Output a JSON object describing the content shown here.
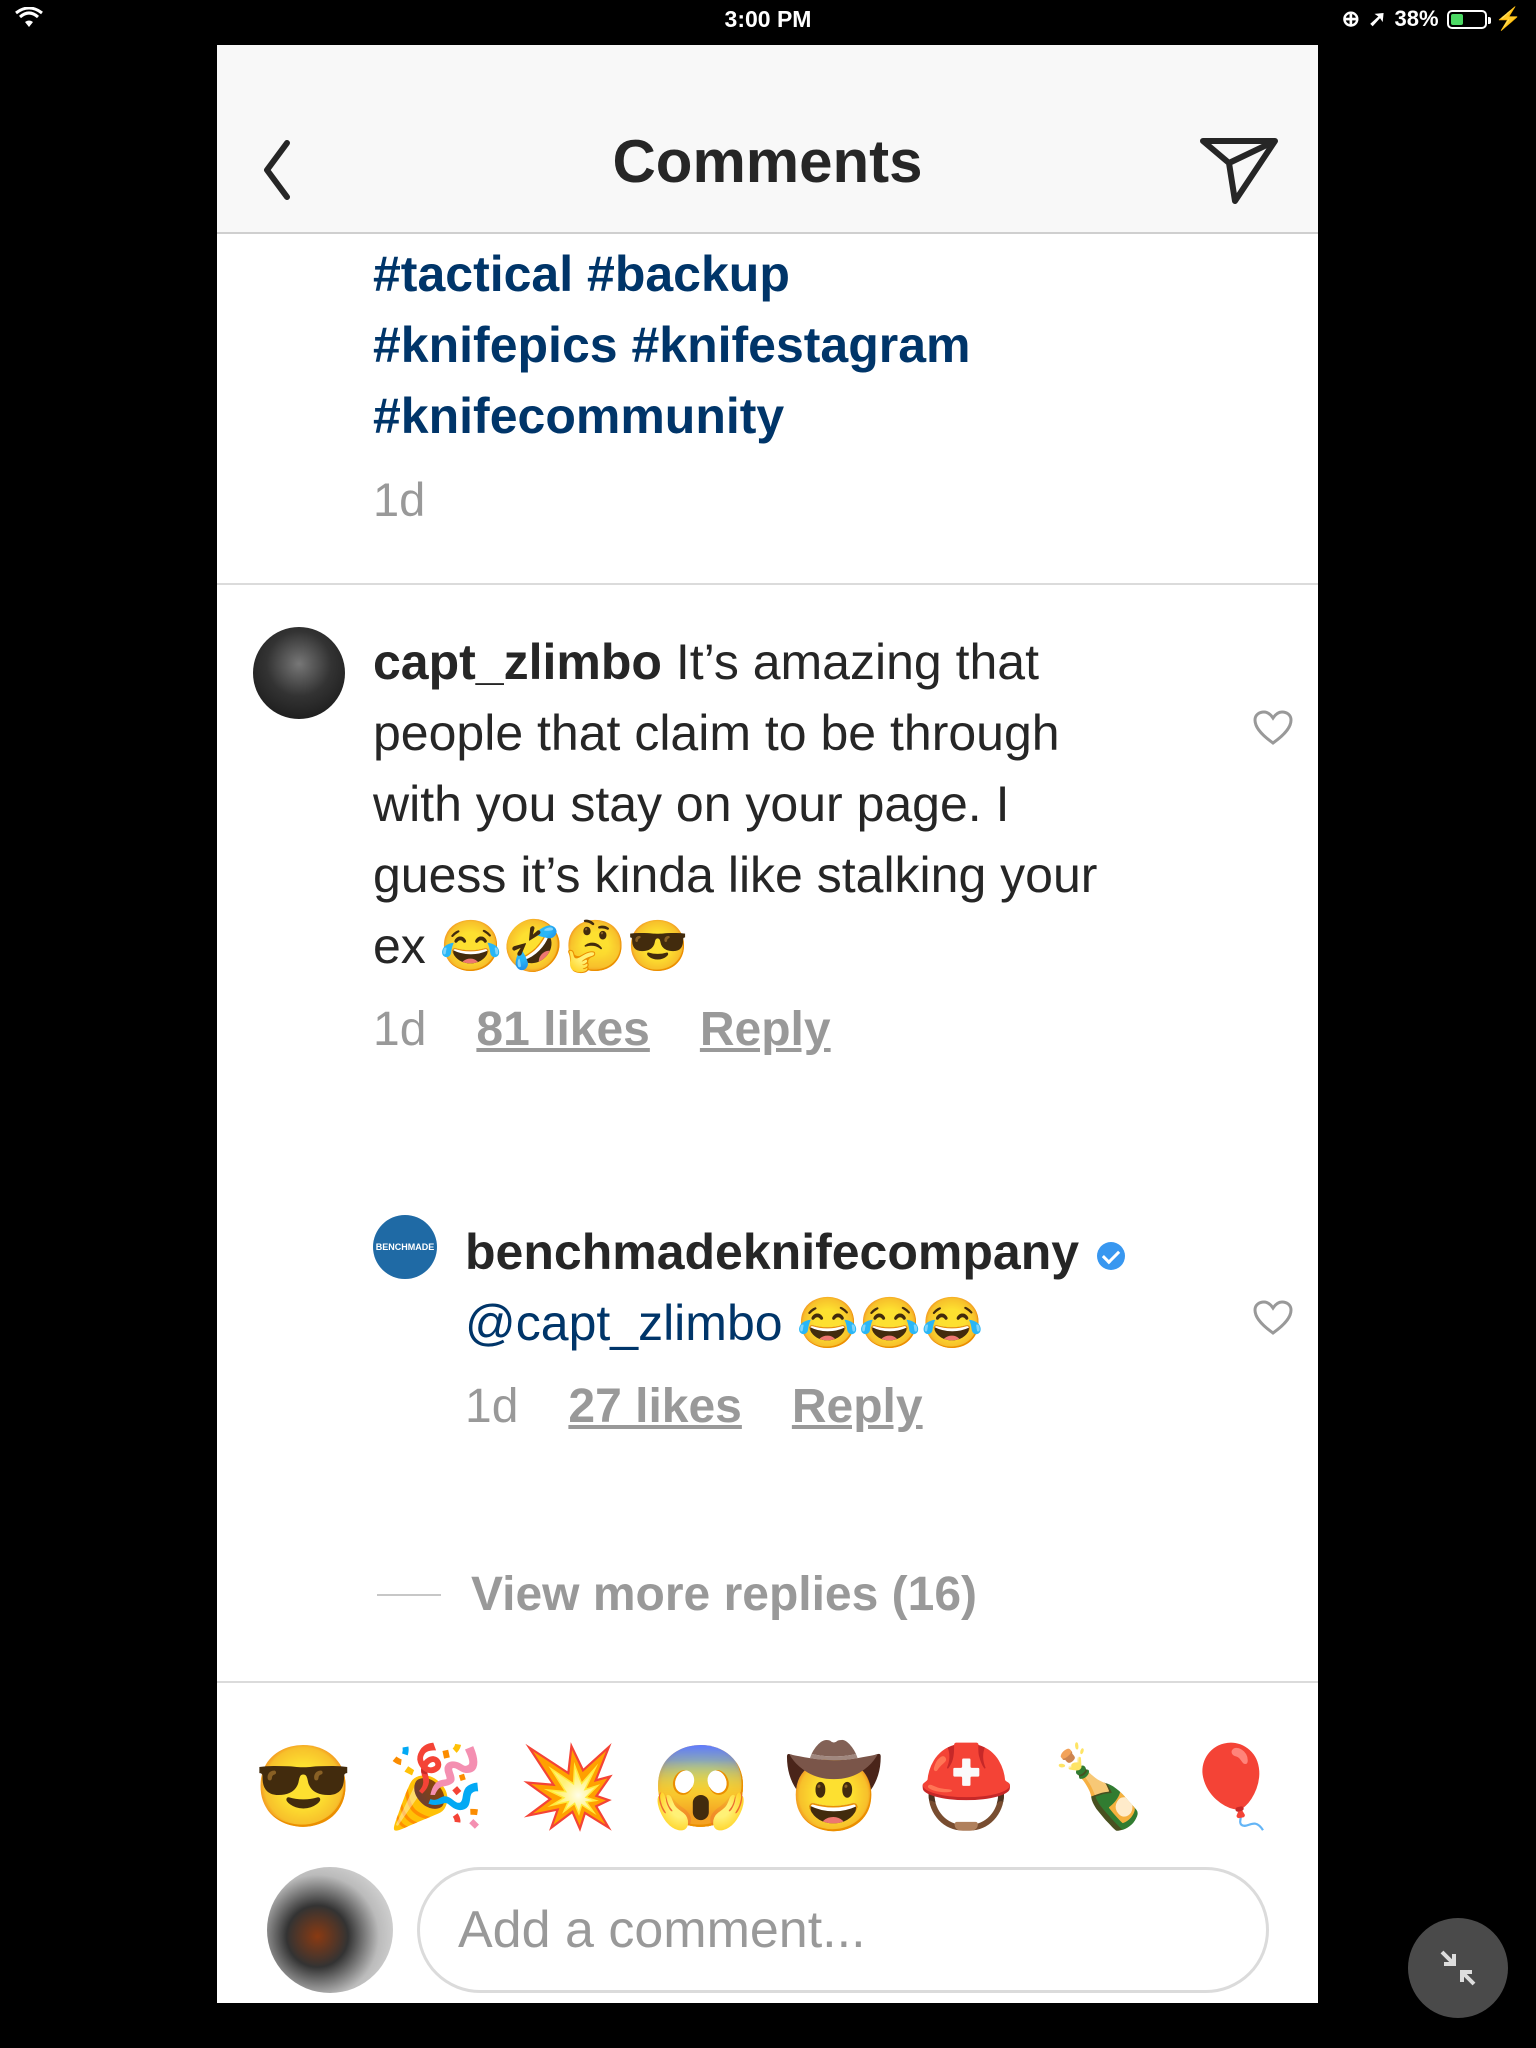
{
  "status_bar": {
    "time": "3:00 PM",
    "battery": "38%",
    "battery_level": 0.38
  },
  "header": {
    "title": "Comments"
  },
  "caption": {
    "hashtag_lines": [
      "#tactical #backup",
      "#knifepics #knifestagram",
      "#knifecommunity"
    ],
    "time": "1d"
  },
  "comments": [
    {
      "username": "capt_zlimbo",
      "text": " It’s amazing that people that claim to be through with you stay on your page. I guess it’s kinda like stalking your ex 😂🤣🤔😎",
      "time": "1d",
      "likes": "81 likes",
      "reply": "Reply"
    },
    {
      "username": "benchmadeknifecompany",
      "mention": "@capt_zlimbo",
      "text": "😂😂😂",
      "time": "1d",
      "likes": "27 likes",
      "reply": "Reply",
      "avatar_text": "BENCHMADE"
    }
  ],
  "view_more": "View more replies (16)",
  "emoji_bar": [
    "😎",
    "🎉",
    "💥",
    "😱",
    "🤠",
    "⛑️",
    "🍾",
    "🎈"
  ],
  "compose": {
    "placeholder": "Add a comment..."
  },
  "colors": {
    "hashtag": "#003569",
    "meta": "#999999",
    "accent": "#3897f0"
  }
}
